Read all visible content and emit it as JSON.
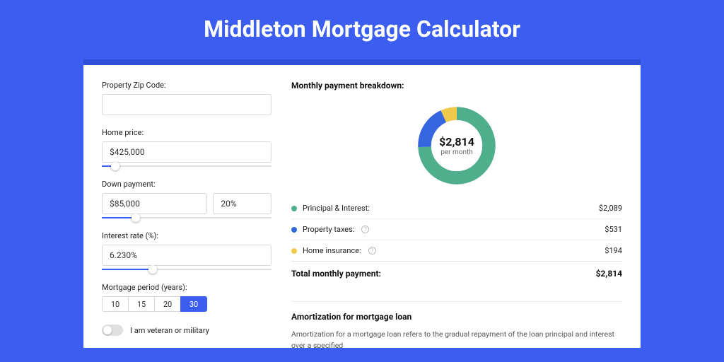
{
  "title": "Middleton Mortgage Calculator",
  "left": {
    "zip_label": "Property Zip Code:",
    "zip_value": "",
    "home_price_label": "Home price:",
    "home_price_value": "$425,000",
    "home_price_slider_pct": 8,
    "down_payment_label": "Down payment:",
    "down_payment_amount": "$85,000",
    "down_payment_pct": "20%",
    "down_payment_slider_pct": 20,
    "interest_label": "Interest rate (%):",
    "interest_value": "6.230%",
    "interest_slider_pct": 30,
    "period_label": "Mortgage period (years):",
    "periods": [
      "10",
      "15",
      "20",
      "30"
    ],
    "period_selected": "30",
    "veteran_label": "I am veteran or military"
  },
  "right": {
    "breakdown_title": "Monthly payment breakdown:",
    "donut_amount": "$2,814",
    "donut_sub": "per month",
    "legend": [
      {
        "label": "Principal & Interest:",
        "value": "$2,089",
        "color": "green",
        "info": false
      },
      {
        "label": "Property taxes:",
        "value": "$531",
        "color": "blue",
        "info": true
      },
      {
        "label": "Home insurance:",
        "value": "$194",
        "color": "yellow",
        "info": true
      }
    ],
    "total_label": "Total monthly payment:",
    "total_value": "$2,814",
    "amort_title": "Amortization for mortgage loan",
    "amort_text": "Amortization for a mortgage loan refers to the gradual repayment of the loan principal and interest over a specified"
  },
  "chart_data": {
    "type": "pie",
    "title": "Monthly payment breakdown",
    "series": [
      {
        "name": "Principal & Interest",
        "value": 2089,
        "color": "#4fae8b"
      },
      {
        "name": "Property taxes",
        "value": 531,
        "color": "#3665e0"
      },
      {
        "name": "Home insurance",
        "value": 194,
        "color": "#f0c94a"
      }
    ],
    "total": 2814,
    "center_label": "$2,814 per month"
  }
}
